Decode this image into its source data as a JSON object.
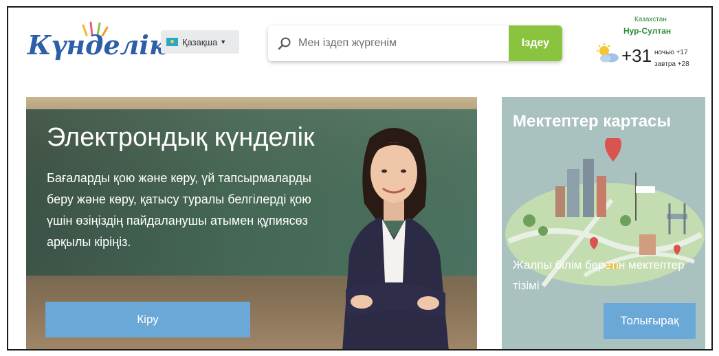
{
  "header": {
    "logo_text": "Күнделік",
    "language": {
      "selected": "Қазақша"
    },
    "search": {
      "placeholder": "Мен іздеп жүргенім",
      "button_label": "Іздеу"
    },
    "weather": {
      "country": "Казахстан",
      "city": "Нур-Султан",
      "temperature": "+31",
      "night": "ночью +17",
      "tomorrow": "завтра +28",
      "icon": "sun-cloud-icon"
    }
  },
  "hero": {
    "title": "Электрондық күнделік",
    "text": "Бағаларды қою және көру, үй тапсырмаларды беру және көру, қатысу туралы белгілерді қою үшін өзіңіздің пайдаланушы атымен құпиясөз арқылы кіріңіз.",
    "login_button": "Кіру"
  },
  "map_card": {
    "title": "Мектептер картасы",
    "description": "Жалпы білім беретін мектептер тізімі",
    "more_button": "Толығырақ"
  },
  "colors": {
    "logo_blue": "#2d5fa8",
    "search_green": "#8ac43f",
    "button_blue": "#6aa8d8",
    "weather_green": "#2e8b3a"
  }
}
